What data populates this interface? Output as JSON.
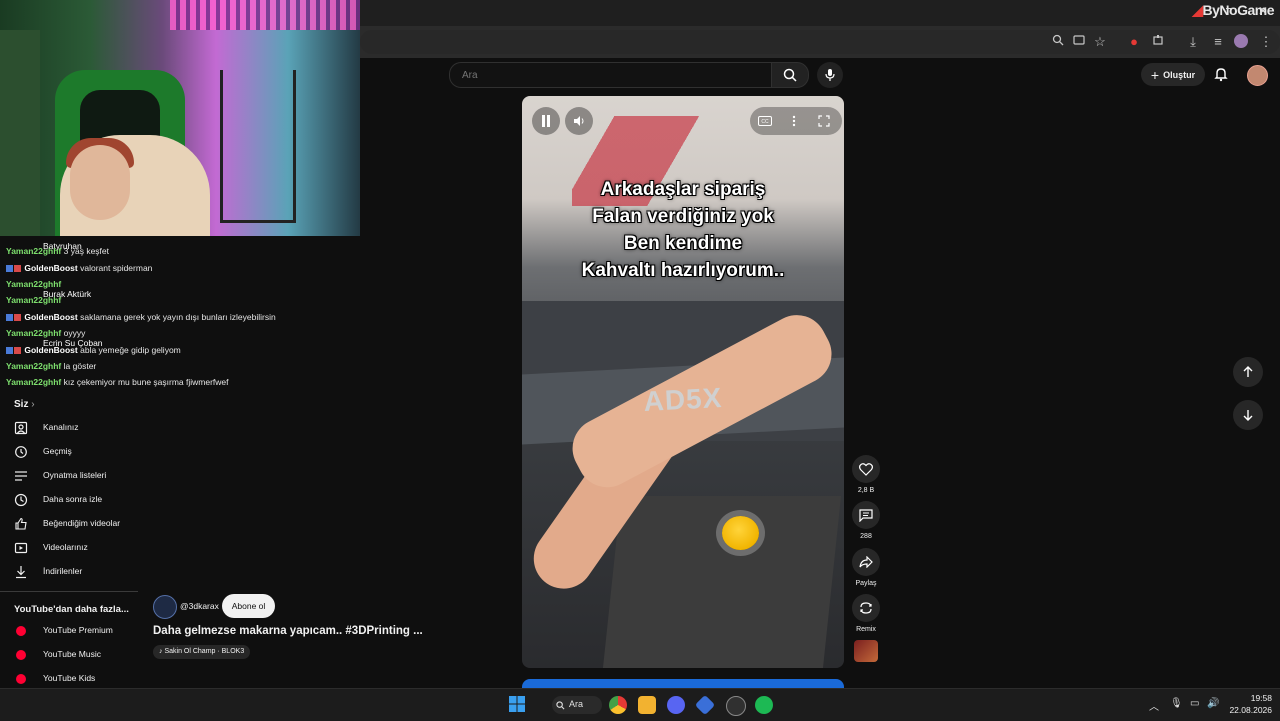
{
  "brand": {
    "logo_text": "ByNoGame"
  },
  "search": {
    "placeholder": "Ara"
  },
  "header": {
    "create_label": "Oluştur"
  },
  "chat": {
    "lines": [
      {
        "user": "Yaman22ghhf",
        "message": "3 yaş keşfet"
      },
      {
        "user": "GoldenBoost",
        "message": "valorant spiderman"
      },
      {
        "user": "Yaman22ghhf",
        "message": ""
      },
      {
        "user": "Yaman22ghhf",
        "message": ""
      },
      {
        "user": "GoldenBoost",
        "message": "saklamana gerek yok yayın dışı bunları izleyebilirsin"
      },
      {
        "user": "Yaman22ghhf",
        "message": "oyyyy"
      },
      {
        "user": "GoldenBoost",
        "message": "abla yemeğe gidip geliyom"
      },
      {
        "user": "Yaman22ghhf",
        "message": "la göster"
      },
      {
        "user": "Yaman22ghhf",
        "message": "kız çekemiyor mu bune şaşırma fjiwmerfwef"
      }
    ],
    "ghost_names": [
      "Batyruhan",
      "Burak Aktürk",
      "Ecrin Su Çoban"
    ]
  },
  "sidebar": {
    "you_title": "Siz",
    "you_items": [
      {
        "label": "Kanalınız",
        "icon": "user-box-icon"
      },
      {
        "label": "Geçmiş",
        "icon": "history-icon"
      },
      {
        "label": "Oynatma listeleri",
        "icon": "playlist-icon"
      },
      {
        "label": "Daha sonra izle",
        "icon": "clock-icon"
      },
      {
        "label": "Beğendiğim videolar",
        "icon": "thumbs-up-icon"
      },
      {
        "label": "Videolarınız",
        "icon": "video-icon"
      },
      {
        "label": "İndirilenler",
        "icon": "download-icon"
      }
    ],
    "more_title": "YouTube'dan daha fazla...",
    "more_items": [
      {
        "label": "YouTube Premium"
      },
      {
        "label": "YouTube Music"
      },
      {
        "label": "YouTube Kids"
      }
    ]
  },
  "short": {
    "overlay_lines": [
      "Arkadaşlar sipariş",
      "Falan verdiğiniz yok",
      "Ben kendime",
      "Kahvaltı hazırlıyorum.."
    ],
    "brand_on_machine": "AD5X",
    "channel": "@3dkarax",
    "subscribe_label": "Abone ol",
    "title": "Daha gelmezse makarna yapıcam.. #3DPrinting ...",
    "sound": "Sakin Ol Champ · BLOK3",
    "actions": {
      "like_count": "2,8 B",
      "comment_count": "288",
      "share_label": "Paylaş",
      "remix_label": "Remix"
    }
  },
  "taskbar": {
    "search_label": "Ara",
    "time": "19:58",
    "date": "22.08.2026"
  },
  "colors": {
    "accent_red": "#ff0033",
    "chat_user_green": "#7ee06e",
    "background": "#0f0f0f"
  }
}
